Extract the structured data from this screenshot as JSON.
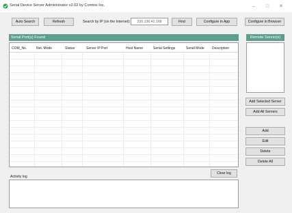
{
  "window": {
    "title": "Serial Device Server Administrator v2.03 by Comtos Inc.",
    "minimize": "–",
    "maximize": "□",
    "close": "✕"
  },
  "toolbar": {
    "auto_search": "Auto Search",
    "refresh": "Refresh",
    "search_by_ip_label": "Search by IP (on the Internet):",
    "ip_value": "220.136.42.168",
    "find": "Find",
    "configure_in_app": "Configure in App",
    "configure_in_browser": "Configure in Browser"
  },
  "serial_ports": {
    "header": "Serial Port(s) Found",
    "columns": [
      "COM_No.",
      "Net. Mode",
      "Status",
      "Server IP Port",
      "Host Name",
      "Serial Settings",
      "Serall Mode",
      "Description"
    ]
  },
  "remote_servers": {
    "header": "Remote Server(s)",
    "add_selected": "Add Selected Server",
    "add_all": "Add All Servers",
    "add": "Add",
    "edit": "Edit",
    "delete": "Delete",
    "delete_all": "Delete All"
  },
  "activity": {
    "label": "Activity log",
    "clear_log": "Clear log"
  },
  "colors": {
    "panel_header": "#5f9e8e",
    "app_icon": "#2f9e44"
  },
  "icons": {
    "app": "app-logo-icon"
  }
}
